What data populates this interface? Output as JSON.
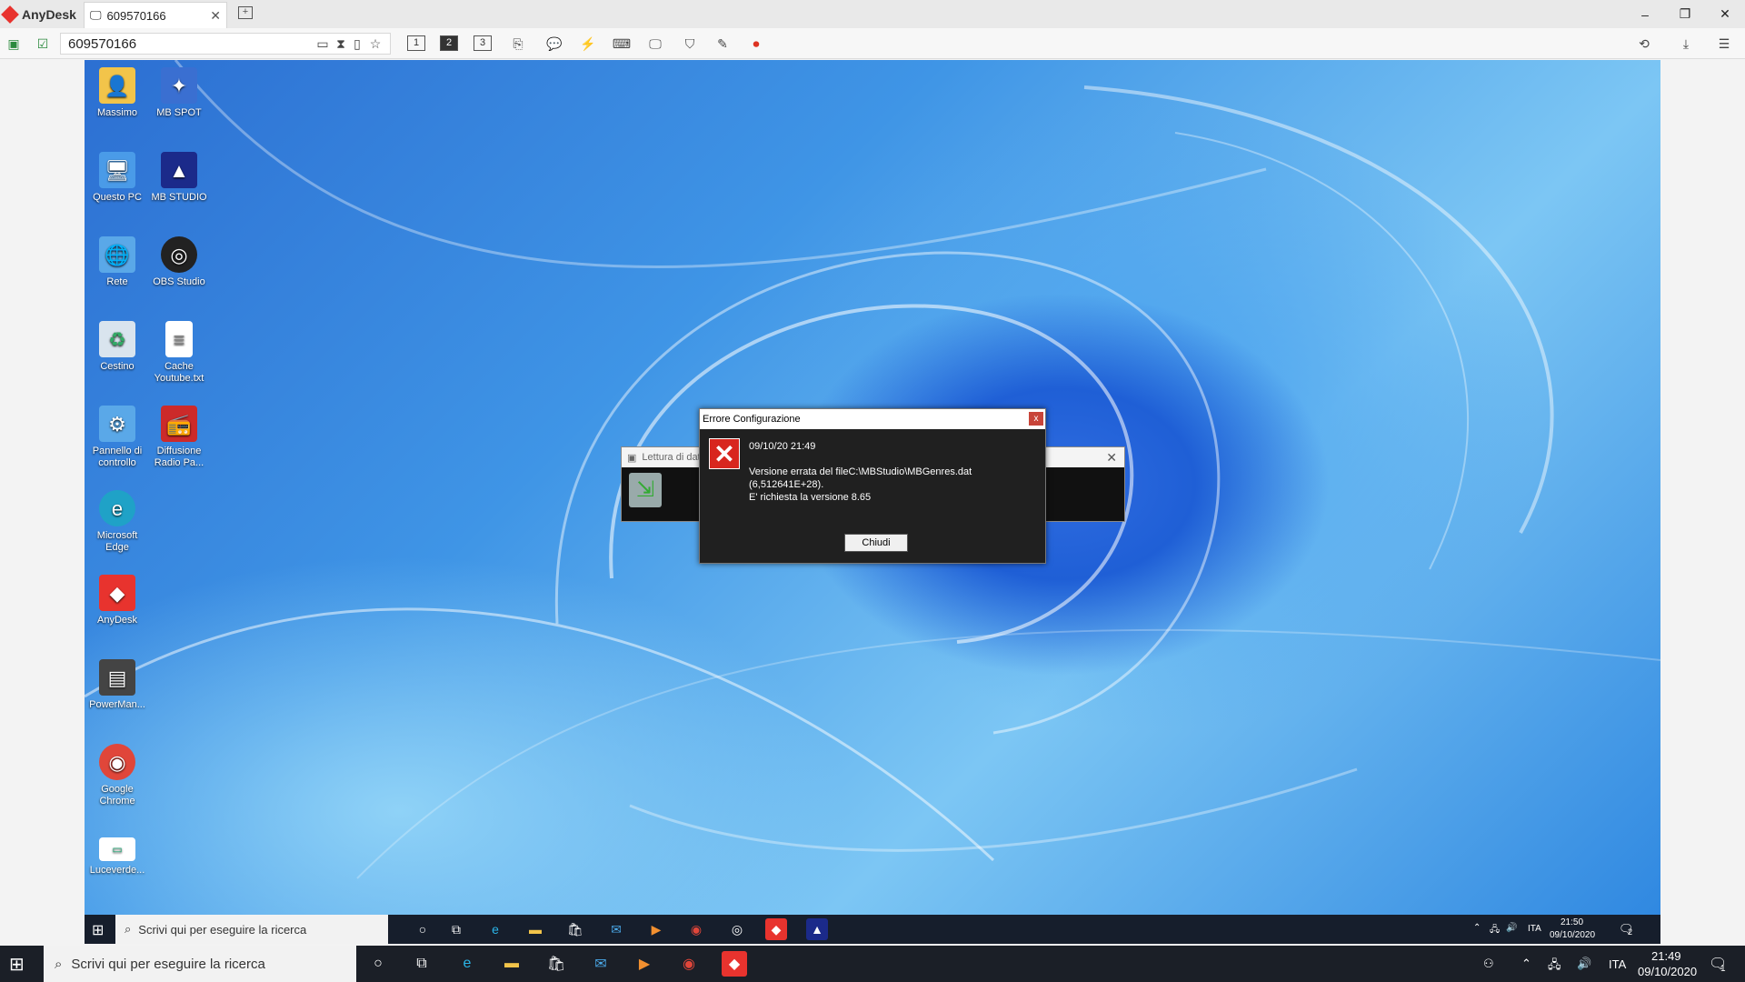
{
  "anydesk": {
    "brand": "AnyDesk",
    "tab_label": "609570166",
    "address_value": "609570166",
    "monitors": [
      "1",
      "2",
      "3"
    ],
    "active_monitor": "2"
  },
  "desktop_icons": [
    {
      "label": "Massimo",
      "icon": "user-folder-icon",
      "color": "#f2c44a"
    },
    {
      "label": "MB SPOT",
      "icon": "mb-spot-icon",
      "color": "#3a6fd1"
    },
    {
      "label": "Questo PC",
      "icon": "computer-icon",
      "color": "#4a9be8"
    },
    {
      "label": "MB STUDIO",
      "icon": "mb-studio-icon",
      "color": "#1b2a8a"
    },
    {
      "label": "Rete",
      "icon": "network-icon",
      "color": "#5aa8e8"
    },
    {
      "label": "OBS Studio",
      "icon": "obs-icon",
      "color": "#222222"
    },
    {
      "label": "Cestino",
      "icon": "recycle-bin-icon",
      "color": "#d9e4ee"
    },
    {
      "label": "Cache Youtube.txt",
      "icon": "text-file-icon",
      "color": "#ffffff"
    },
    {
      "label": "Pannello di controllo",
      "icon": "control-panel-icon",
      "color": "#5aa8e8"
    },
    {
      "label": "Diffusione Radio Pa...",
      "icon": "radio-app-icon",
      "color": "#cc2a2a"
    },
    {
      "label": "Microsoft Edge",
      "icon": "edge-icon",
      "color": "#1fa2c7"
    },
    {
      "label": "AnyDesk",
      "icon": "anydesk-icon",
      "color": "#e8332e"
    },
    {
      "label": "PowerMan...",
      "icon": "powerman-icon",
      "color": "#444444"
    },
    {
      "label": "Google Chrome",
      "icon": "chrome-icon",
      "color": "#e0463a"
    },
    {
      "label": "Luceverde...",
      "icon": "luceverde-icon",
      "color": "#ffffff"
    }
  ],
  "lettura_dialog": {
    "title": "Lettura di dat"
  },
  "error_dialog": {
    "title": "Errore Configurazione",
    "close_label": "x",
    "timestamp": "09/10/20 21:49",
    "line1": "Versione errata del fileC:\\MBStudio\\MBGenres.dat",
    "line2": "(6,512641E+28).",
    "line3": "E' richiesta la versione 8.65",
    "button": "Chiudi"
  },
  "remote_taskbar": {
    "search_placeholder": "Scrivi qui per eseguire la ricerca",
    "lang": "ITA",
    "time": "21:50",
    "date": "09/10/2020",
    "notifications": "2"
  },
  "taskbar": {
    "search_placeholder": "Scrivi qui per eseguire la ricerca",
    "lang": "ITA",
    "time": "21:49",
    "date": "09/10/2020",
    "notifications": "1"
  }
}
